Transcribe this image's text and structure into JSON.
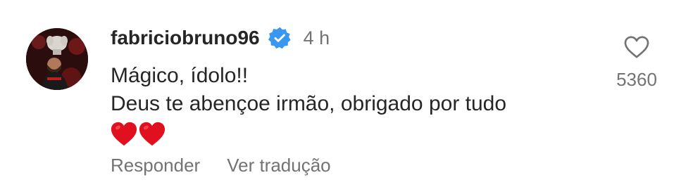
{
  "comment": {
    "username": "fabriciobruno96",
    "verified": true,
    "timestamp": "4 h",
    "text_lines": [
      "Mágico, ídolo!!",
      "Deus te abençoe irmão, obrigado por tudo"
    ],
    "emoji": [
      "red-heart",
      "red-heart"
    ],
    "actions": {
      "reply_label": "Responder",
      "translate_label": "Ver tradução"
    },
    "likes": {
      "count": "5360"
    }
  },
  "colors": {
    "primary_text": "#262626",
    "secondary_text": "#737373",
    "verified_blue": "#3897f0",
    "heart_red": "#e0101e"
  }
}
